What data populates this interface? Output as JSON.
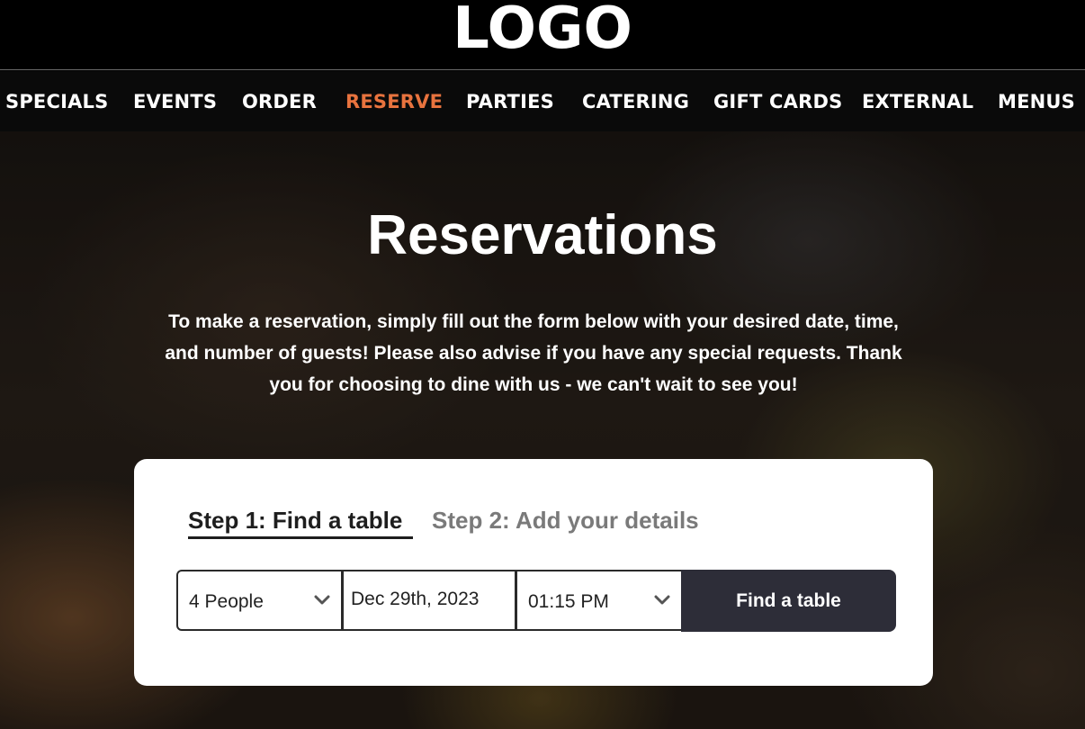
{
  "header": {
    "logo_text": "LOGO"
  },
  "nav": {
    "items": [
      {
        "label": "SPECIALS",
        "active": false
      },
      {
        "label": "EVENTS",
        "active": false
      },
      {
        "label": "ORDER",
        "active": false
      },
      {
        "label": "RESERVE",
        "active": true
      },
      {
        "label": "PARTIES",
        "active": false
      },
      {
        "label": "CATERING",
        "active": false
      },
      {
        "label": "GIFT CARDS",
        "active": false
      },
      {
        "label": "EXTERNAL",
        "active": false
      },
      {
        "label": "MENUS",
        "active": false
      }
    ],
    "active_color": "#e8733e"
  },
  "page": {
    "title": "Reservations",
    "intro_lines": [
      "To make a reservation, simply fill out the form below with your desired date, time,",
      "and number of guests! Please also advise if you have any special requests. Thank",
      "you for choosing to dine with us - we can't wait to see you!"
    ]
  },
  "reservation": {
    "step1_label": "Step 1: Find a table",
    "step2_label": "Step 2: Add your details",
    "party_size": "4 People",
    "date": "Dec 29th, 2023",
    "time": "01:15 PM",
    "submit_label": "Find a table",
    "icons": {
      "party_dropdown": "chevron-down-icon",
      "time_dropdown": "chevron-down-icon"
    },
    "button_color": "#2d2d38"
  }
}
